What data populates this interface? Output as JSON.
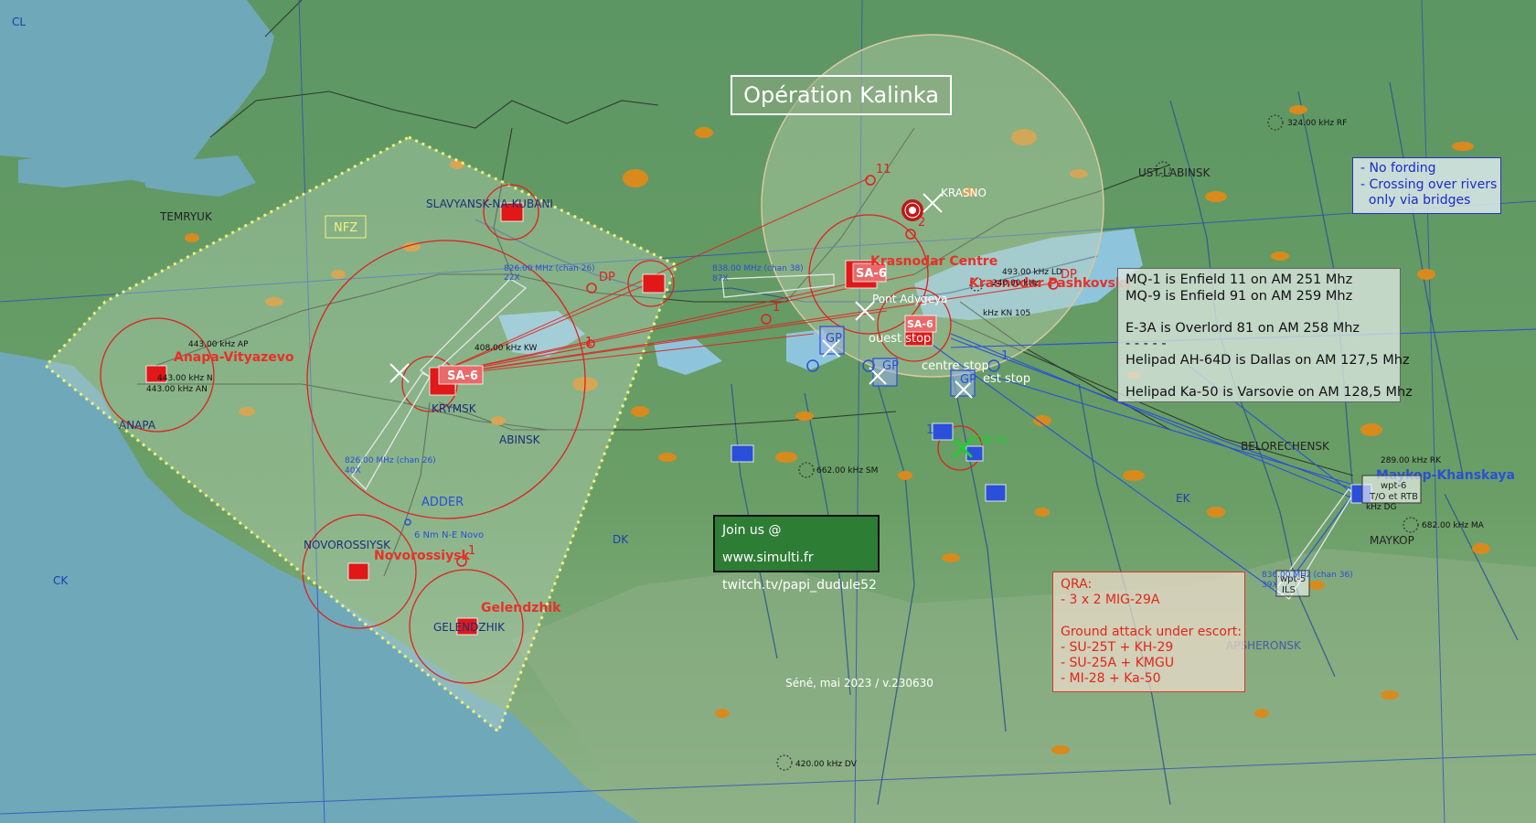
{
  "title": "Opération Kalinka",
  "corners": {
    "top_left": "CL",
    "left": "CK",
    "bottom_center": "DK",
    "right": "EK"
  },
  "areas": {
    "nfz": "NFZ",
    "coverage_circle_color": "#d9c8a0",
    "threat_color": "#e02020",
    "friendly_color": "#2a4fd8",
    "sea_color": "#6fa8b8",
    "land_color": "#5f9a64"
  },
  "towns": [
    {
      "name": "TEMRYUK"
    },
    {
      "name": "SLAVYANSK-NA-KUBANI"
    },
    {
      "name": "KRYMSK"
    },
    {
      "name": "ANAPA"
    },
    {
      "name": "ABINSK"
    },
    {
      "name": "NOVOROSSIYSK"
    },
    {
      "name": "GELENDZHIK"
    },
    {
      "name": "KRASNO"
    },
    {
      "name": "UST-LABINSK"
    },
    {
      "name": "BELORECHENSK"
    },
    {
      "name": "MAYKOP"
    },
    {
      "name": "APSHERONSK"
    }
  ],
  "airfields": [
    {
      "name": "Anapa-Vityazevo"
    },
    {
      "name": "Novorossiysk"
    },
    {
      "name": "Gelendzhik"
    },
    {
      "name": "Krasnodar Centre"
    },
    {
      "name": "Krasnodar Pashkovsky"
    },
    {
      "name": "Maykop-Khanskaya"
    }
  ],
  "threats": [
    {
      "label": "SA-6"
    },
    {
      "label": "SA-6"
    },
    {
      "label": "SA-6"
    }
  ],
  "waypoints": {
    "dp_labels": [
      "DP",
      "DP"
    ],
    "adder": "ADDER",
    "adder_note": "6 Nm N-E Novo",
    "nums": [
      "1",
      "1",
      "1",
      "1",
      "1",
      "11",
      "2"
    ],
    "wpt6": "wpt-6",
    "wpt6_sub": "T/O et RTB",
    "wpt5": "wpt-5",
    "wpt5_sub": "ILS",
    "fob": "FOB HL"
  },
  "stops": [
    {
      "label": "GP",
      "sub": "ouest stop"
    },
    {
      "label": "GP",
      "sub": "centre stop"
    },
    {
      "label": "GP",
      "sub": "est stop"
    }
  ],
  "place_extra": {
    "pont": "Pont Adygeya"
  },
  "navaids": [
    {
      "label": "826.00 MHz (chan 26)",
      "sub": "22X"
    },
    {
      "label": "826.00 MHz (chan 26)",
      "sub": "40X"
    },
    {
      "label": "838.00 MHz (chan 38)",
      "sub": "87X"
    },
    {
      "label": "836.00 MHz (chan 36)",
      "sub": "39X"
    },
    {
      "label": "408.00 kHz KW"
    },
    {
      "label": "443.00 kHz AP"
    },
    {
      "label": "443.00 kHz N"
    },
    {
      "label": "443.00 kHz AN"
    },
    {
      "label": "662.00 kHz SM"
    },
    {
      "label": "682.00 kHz MA"
    },
    {
      "label": "420.00 kHz DV"
    },
    {
      "label": "324.00 kHz RF"
    },
    {
      "label": "493.00 kHz LD"
    },
    {
      "label": "240.00 kHz"
    },
    {
      "label": "289.00 kHz RK"
    },
    {
      "label": "kHz KN 105"
    },
    {
      "label": "kHz DG"
    }
  ],
  "rules": [
    "- No fording",
    "- Crossing over rivers",
    "  only via bridges"
  ],
  "comms": [
    "MQ-1 is Enfield 11 on AM 251 Mhz",
    "MQ-9 is Enfield 91 on AM 259 Mhz",
    "",
    "E-3A is Overlord 81 on AM 258 Mhz",
    "- - - - -",
    "Helipad AH-64D is Dallas  on AM 127,5 Mhz",
    "",
    "Helipad Ka-50 is Varsovie  on AM 128,5 Mhz"
  ],
  "join": {
    "line1": "Join us @ www.simulti.fr",
    "line2": "twitch.tv/papi_dudule52"
  },
  "qra": [
    "QRA:",
    "- 3 x 2 MIG-29A",
    "",
    "Ground attack under escort:",
    "- SU-25T + KH-29",
    "- SU-25A + KMGU",
    "- MI-28 + Ka-50"
  ],
  "footer": "Séné, mai 2023 / v.230630"
}
